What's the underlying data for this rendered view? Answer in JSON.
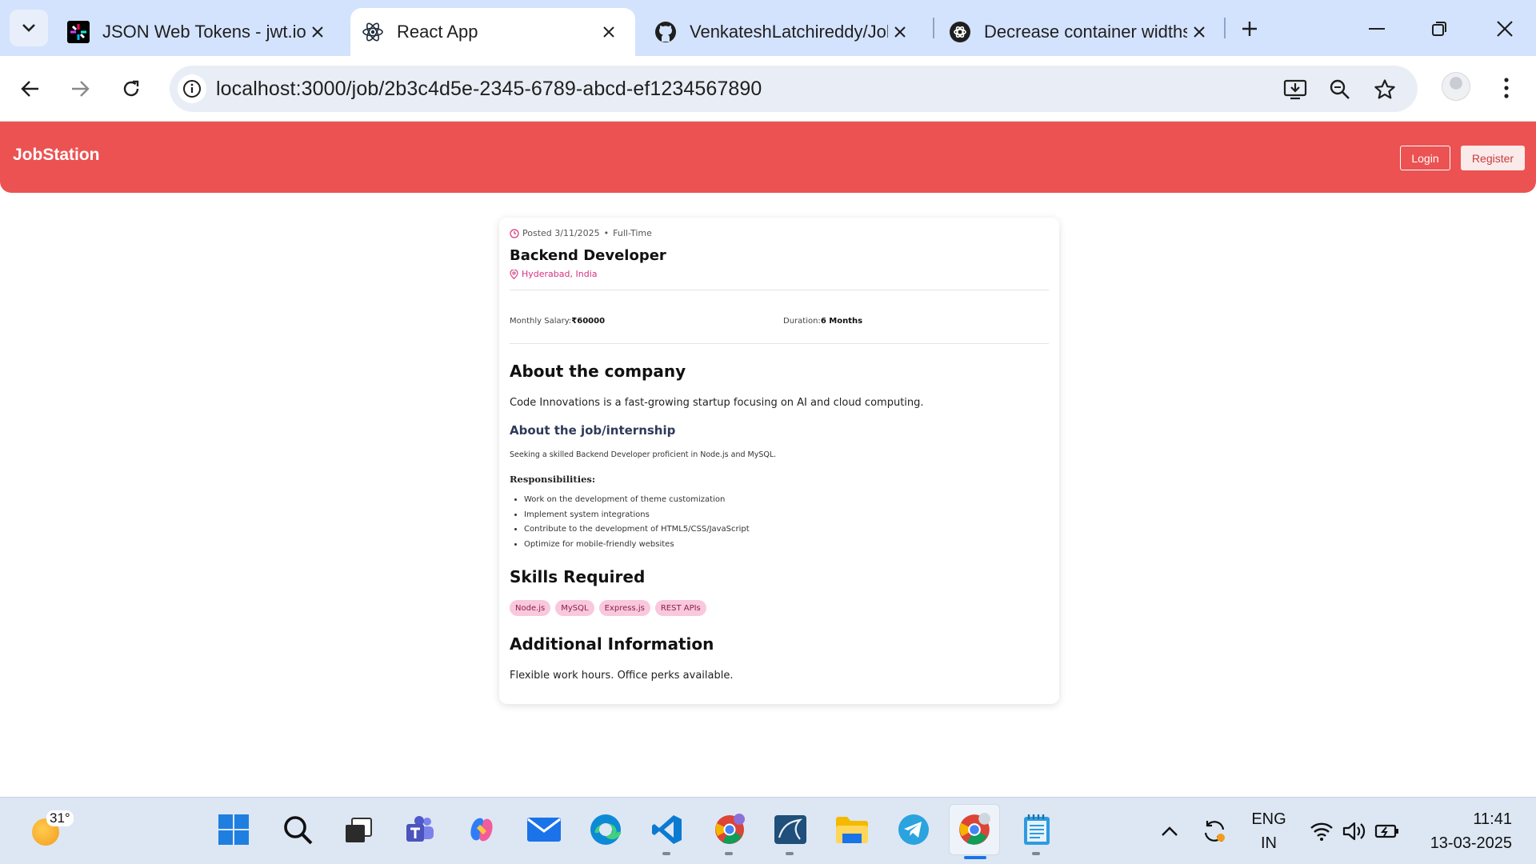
{
  "browser": {
    "tabs": [
      {
        "title": "JSON Web Tokens - jwt.io",
        "icon": "jwt-icon",
        "active": false
      },
      {
        "title": "React App",
        "icon": "react-icon",
        "active": true
      },
      {
        "title": "VenkateshLatchireddy/Job",
        "icon": "github-icon",
        "active": false
      },
      {
        "title": "Decrease container widths",
        "icon": "chatgpt-icon",
        "active": false
      }
    ],
    "url": "localhost:3000/job/2b3c4d5e-2345-6789-abcd-ef1234567890"
  },
  "header": {
    "brand": "JobStation",
    "login_label": "Login",
    "register_label": "Register",
    "accent": "#ec5252"
  },
  "job": {
    "posted": "Posted 3/11/2025",
    "separator": "•",
    "type": "Full-Time",
    "title": "Backend Developer",
    "location": "Hyderabad, India",
    "salary_label": "Monthly Salary:",
    "salary_value": "₹60000",
    "duration_label": "Duration:",
    "duration_value": "6 Months",
    "about_company_heading": "About the company",
    "about_company_text": "Code Innovations is a fast-growing startup focusing on AI and cloud computing.",
    "about_job_heading": "About the job/internship",
    "about_job_text": "Seeking a skilled Backend Developer proficient in Node.js and MySQL.",
    "responsibilities_heading": "Responsibilities:",
    "responsibilities": [
      "Work on the development of theme customization",
      "Implement system integrations",
      "Contribute to the development of HTML5/CSS/JavaScript",
      "Optimize for mobile-friendly websites"
    ],
    "skills_heading": "Skills Required",
    "skills": [
      "Node.js",
      "MySQL",
      "Express.js",
      "REST APIs"
    ],
    "additional_heading": "Additional Information",
    "additional_text": "Flexible work hours. Office perks available."
  },
  "taskbar": {
    "weather_temp": "31°",
    "language_top": "ENG",
    "language_bottom": "IN",
    "time": "11:41",
    "date": "13-03-2025"
  }
}
